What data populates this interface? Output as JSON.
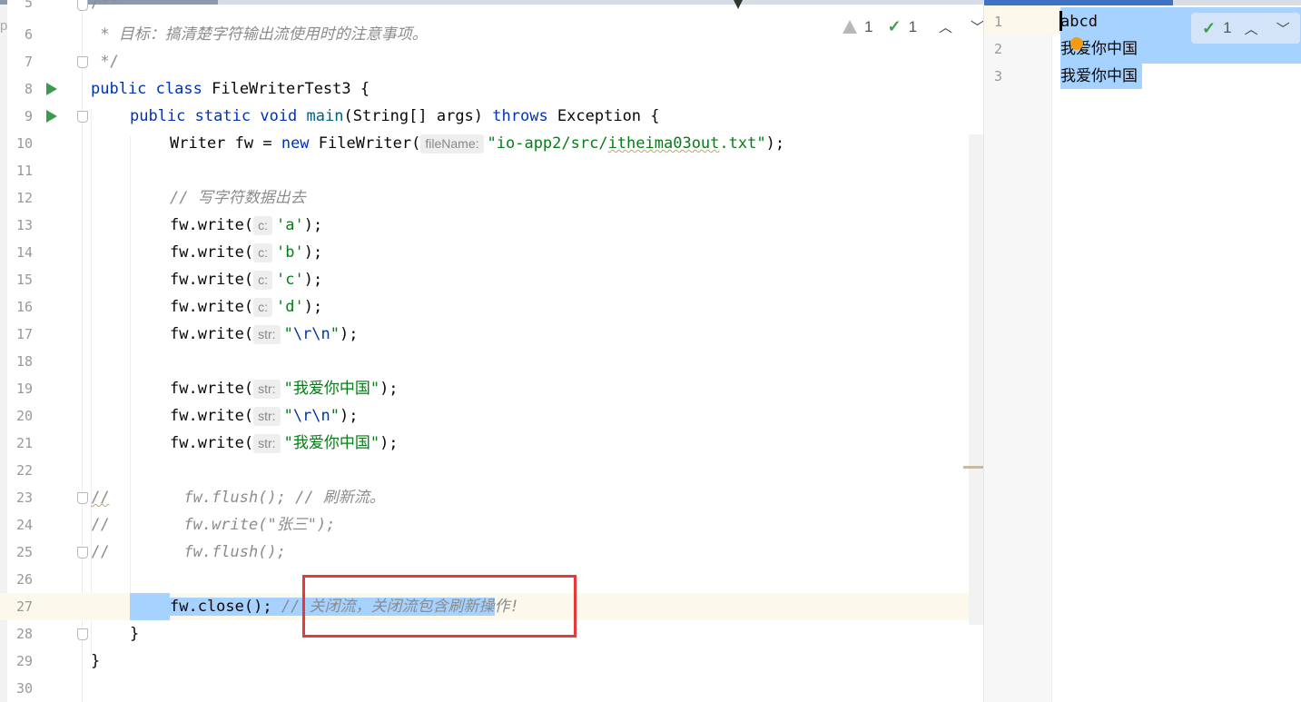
{
  "editor": {
    "warnings_count": "1",
    "checks_count": "1",
    "lines": [
      {
        "n": "5",
        "text": "/**"
      },
      {
        "n": "6",
        "text": " * 目标：搞清楚字符输出流使用时的注意事项。"
      },
      {
        "n": "7",
        "text": " */"
      },
      {
        "n": "8",
        "kw1": "public",
        "kw2": "class",
        "name": "FileWriterTest3",
        "rest": " {"
      },
      {
        "n": "9",
        "kw1": "public",
        "kw2": "static",
        "kw3": "void",
        "name": "main",
        "args": "(String[] args) ",
        "kw4": "throws",
        "rest": " Exception {"
      },
      {
        "n": "10",
        "lead": "Writer fw = ",
        "kw": "new",
        "mid": " FileWriter(",
        "hint": "fileName:",
        "str_a": "\"io-app2/src/",
        "str_squig": "itheima03out",
        "str_b": ".txt\"",
        "rest": ");"
      },
      {
        "n": "11"
      },
      {
        "n": "12",
        "comment": "// 写字符数据出去"
      },
      {
        "n": "13",
        "call": "fw.write(",
        "hint": "c:",
        "val": "'a'",
        "rest": ");"
      },
      {
        "n": "14",
        "call": "fw.write(",
        "hint": "c:",
        "val": "'b'",
        "rest": ");"
      },
      {
        "n": "15",
        "call": "fw.write(",
        "hint": "c:",
        "val": "'c'",
        "rest": ");"
      },
      {
        "n": "16",
        "call": "fw.write(",
        "hint": "c:",
        "val": "'d'",
        "rest": ");"
      },
      {
        "n": "17",
        "call": "fw.write(",
        "hint": "str:",
        "q1": "\"",
        "esc": "\\r\\n",
        "q2": "\"",
        "rest": ");"
      },
      {
        "n": "18"
      },
      {
        "n": "19",
        "call": "fw.write(",
        "hint": "str:",
        "val": "\"我爱你中国\"",
        "rest": ");"
      },
      {
        "n": "20",
        "call": "fw.write(",
        "hint": "str:",
        "q1": "\"",
        "esc": "\\r\\n",
        "q2": "\"",
        "rest": ");"
      },
      {
        "n": "21",
        "call": "fw.write(",
        "hint": "str:",
        "val": "\"我爱你中国\"",
        "rest": ");"
      },
      {
        "n": "22"
      },
      {
        "n": "23",
        "prefix": "//",
        "comment": "        fw.flush(); // 刷新流。"
      },
      {
        "n": "24",
        "prefix": "//",
        "comment": "        fw.write(\"张三\");"
      },
      {
        "n": "25",
        "prefix": "//",
        "comment": "        fw.flush();"
      },
      {
        "n": "26"
      },
      {
        "n": "27",
        "code_sel": "fw.close(); ",
        "comment_sel": "// 关闭流，关闭流包含刷新操",
        "comment_rest": "作!"
      },
      {
        "n": "28",
        "text": "}"
      },
      {
        "n": "29",
        "text": "}"
      },
      {
        "n": "30"
      }
    ]
  },
  "output": {
    "checks_count": "1",
    "lines": [
      {
        "n": "1",
        "text": "abcd"
      },
      {
        "n": "2",
        "text": "我爱你中国"
      },
      {
        "n": "3",
        "text": "我爱你中国"
      }
    ]
  },
  "colors": {
    "keyword": "#0033b3",
    "string": "#067d17",
    "comment": "#8c8c8c",
    "selection": "#a6d2ff",
    "annotation_box": "#e83838"
  }
}
